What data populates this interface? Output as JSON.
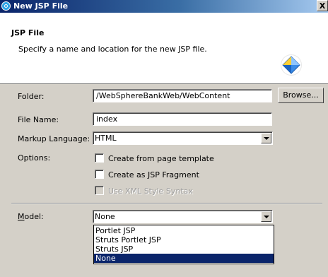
{
  "window": {
    "title": "New JSP File",
    "close_label": "X"
  },
  "header": {
    "title": "JSP File",
    "description": "Specify a name and location for the new JSP file."
  },
  "form": {
    "folder": {
      "label": "Folder:",
      "value": "/WebSphereBankWeb/WebContent",
      "browse_label": "Browse..."
    },
    "file_name": {
      "label": "File Name:",
      "value": "index"
    },
    "markup_language": {
      "label": "Markup Language:",
      "value": "HTML"
    },
    "options": {
      "label": "Options:",
      "items": [
        {
          "label": "Create from page template",
          "checked": false,
          "enabled": true
        },
        {
          "label": "Create as JSP Fragment",
          "checked": false,
          "enabled": true
        },
        {
          "label": "Use XML Style Syntax",
          "checked": false,
          "enabled": false
        }
      ]
    },
    "model": {
      "label": "Model:",
      "value": "None",
      "options": [
        "Portlet JSP",
        "Struts Portlet JSP",
        "Struts JSP",
        "None"
      ],
      "selected_option": "None"
    }
  },
  "colors": {
    "titlebar_start": "#0a246a",
    "titlebar_end": "#a6caf0",
    "selection_bg": "#0a246a",
    "dialog_bg": "#d4d0c8"
  },
  "icons": {
    "app": "eclipse-icon",
    "wizard": "jsp-diamond-icon"
  }
}
